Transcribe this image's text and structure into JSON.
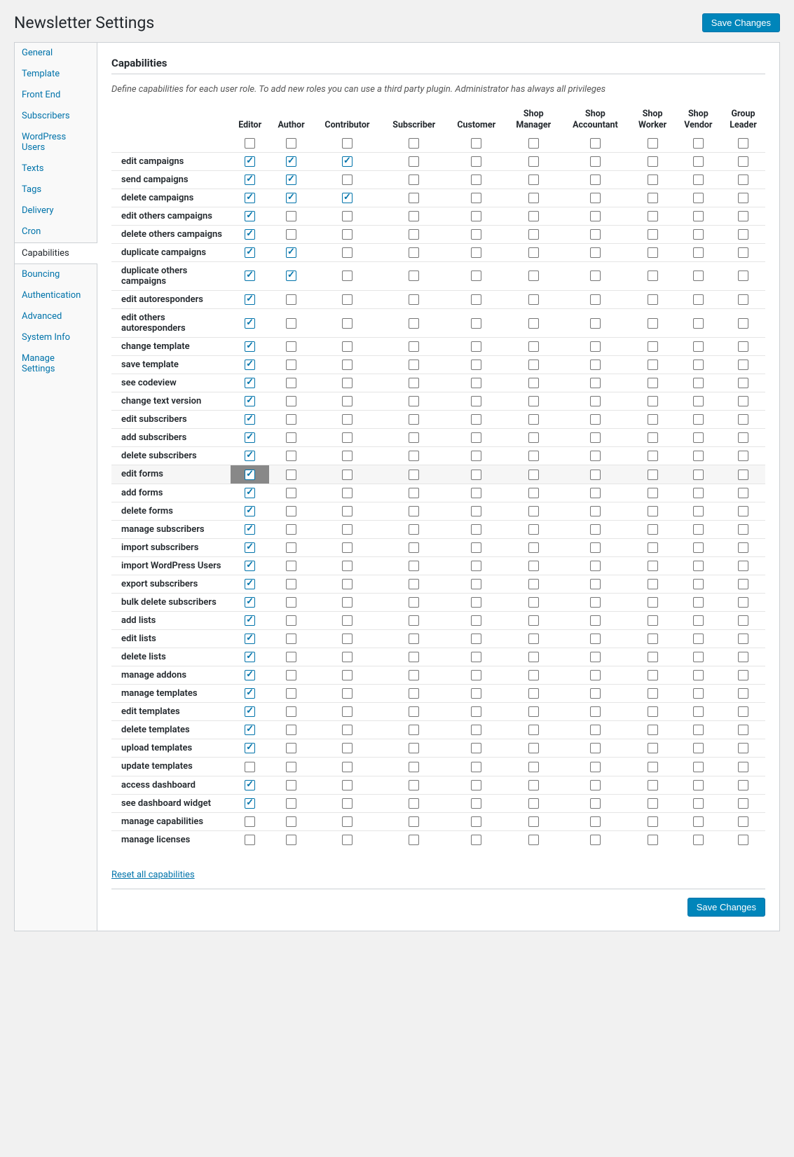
{
  "page_title": "Newsletter Settings",
  "buttons": {
    "save_changes": "Save Changes"
  },
  "sidebar": {
    "items": [
      {
        "label": "General",
        "active": false
      },
      {
        "label": "Template",
        "active": false
      },
      {
        "label": "Front End",
        "active": false
      },
      {
        "label": "Subscribers",
        "active": false
      },
      {
        "label": "WordPress Users",
        "active": false
      },
      {
        "label": "Texts",
        "active": false
      },
      {
        "label": "Tags",
        "active": false
      },
      {
        "label": "Delivery",
        "active": false
      },
      {
        "label": "Cron",
        "active": false
      },
      {
        "label": "Capabilities",
        "active": true
      },
      {
        "label": "Bouncing",
        "active": false
      },
      {
        "label": "Authentication",
        "active": false
      },
      {
        "label": "Advanced",
        "active": false
      },
      {
        "label": "System Info",
        "active": false
      },
      {
        "label": "Manage Settings",
        "active": false
      }
    ]
  },
  "section": {
    "title": "Capabilities",
    "description": "Define capabilities for each user role. To add new roles you can use a third party plugin. Administrator has always all privileges"
  },
  "roles": [
    "Editor",
    "Author",
    "Contributor",
    "Subscriber",
    "Customer",
    "Shop Manager",
    "Shop Accountant",
    "Shop Worker",
    "Shop Vendor",
    "Group Leader"
  ],
  "capabilities": [
    {
      "label": "edit campaigns",
      "highlight": false,
      "values": [
        true,
        true,
        true,
        false,
        false,
        false,
        false,
        false,
        false,
        false
      ]
    },
    {
      "label": "send campaigns",
      "highlight": false,
      "values": [
        true,
        true,
        false,
        false,
        false,
        false,
        false,
        false,
        false,
        false
      ]
    },
    {
      "label": "delete campaigns",
      "highlight": false,
      "values": [
        true,
        true,
        true,
        false,
        false,
        false,
        false,
        false,
        false,
        false
      ]
    },
    {
      "label": "edit others campaigns",
      "highlight": false,
      "values": [
        true,
        false,
        false,
        false,
        false,
        false,
        false,
        false,
        false,
        false
      ]
    },
    {
      "label": "delete others campaigns",
      "highlight": false,
      "values": [
        true,
        false,
        false,
        false,
        false,
        false,
        false,
        false,
        false,
        false
      ]
    },
    {
      "label": "duplicate campaigns",
      "highlight": false,
      "values": [
        true,
        true,
        false,
        false,
        false,
        false,
        false,
        false,
        false,
        false
      ]
    },
    {
      "label": "duplicate others campaigns",
      "highlight": false,
      "values": [
        true,
        true,
        false,
        false,
        false,
        false,
        false,
        false,
        false,
        false
      ]
    },
    {
      "label": "edit autoresponders",
      "highlight": false,
      "values": [
        true,
        false,
        false,
        false,
        false,
        false,
        false,
        false,
        false,
        false
      ]
    },
    {
      "label": "edit others autoresponders",
      "highlight": false,
      "values": [
        true,
        false,
        false,
        false,
        false,
        false,
        false,
        false,
        false,
        false
      ]
    },
    {
      "label": "change template",
      "highlight": false,
      "values": [
        true,
        false,
        false,
        false,
        false,
        false,
        false,
        false,
        false,
        false
      ]
    },
    {
      "label": "save template",
      "highlight": false,
      "values": [
        true,
        false,
        false,
        false,
        false,
        false,
        false,
        false,
        false,
        false
      ]
    },
    {
      "label": "see codeview",
      "highlight": false,
      "values": [
        true,
        false,
        false,
        false,
        false,
        false,
        false,
        false,
        false,
        false
      ]
    },
    {
      "label": "change text version",
      "highlight": false,
      "values": [
        true,
        false,
        false,
        false,
        false,
        false,
        false,
        false,
        false,
        false
      ]
    },
    {
      "label": "edit subscribers",
      "highlight": false,
      "values": [
        true,
        false,
        false,
        false,
        false,
        false,
        false,
        false,
        false,
        false
      ]
    },
    {
      "label": "add subscribers",
      "highlight": false,
      "values": [
        true,
        false,
        false,
        false,
        false,
        false,
        false,
        false,
        false,
        false
      ]
    },
    {
      "label": "delete subscribers",
      "highlight": false,
      "values": [
        true,
        false,
        false,
        false,
        false,
        false,
        false,
        false,
        false,
        false
      ]
    },
    {
      "label": "edit forms",
      "highlight": true,
      "values": [
        true,
        false,
        false,
        false,
        false,
        false,
        false,
        false,
        false,
        false
      ]
    },
    {
      "label": "add forms",
      "highlight": false,
      "values": [
        true,
        false,
        false,
        false,
        false,
        false,
        false,
        false,
        false,
        false
      ]
    },
    {
      "label": "delete forms",
      "highlight": false,
      "values": [
        true,
        false,
        false,
        false,
        false,
        false,
        false,
        false,
        false,
        false
      ]
    },
    {
      "label": "manage subscribers",
      "highlight": false,
      "values": [
        true,
        false,
        false,
        false,
        false,
        false,
        false,
        false,
        false,
        false
      ]
    },
    {
      "label": "import subscribers",
      "highlight": false,
      "values": [
        true,
        false,
        false,
        false,
        false,
        false,
        false,
        false,
        false,
        false
      ]
    },
    {
      "label": "import WordPress Users",
      "highlight": false,
      "values": [
        true,
        false,
        false,
        false,
        false,
        false,
        false,
        false,
        false,
        false
      ]
    },
    {
      "label": "export subscribers",
      "highlight": false,
      "values": [
        true,
        false,
        false,
        false,
        false,
        false,
        false,
        false,
        false,
        false
      ]
    },
    {
      "label": "bulk delete subscribers",
      "highlight": false,
      "values": [
        true,
        false,
        false,
        false,
        false,
        false,
        false,
        false,
        false,
        false
      ]
    },
    {
      "label": "add lists",
      "highlight": false,
      "values": [
        true,
        false,
        false,
        false,
        false,
        false,
        false,
        false,
        false,
        false
      ]
    },
    {
      "label": "edit lists",
      "highlight": false,
      "values": [
        true,
        false,
        false,
        false,
        false,
        false,
        false,
        false,
        false,
        false
      ]
    },
    {
      "label": "delete lists",
      "highlight": false,
      "values": [
        true,
        false,
        false,
        false,
        false,
        false,
        false,
        false,
        false,
        false
      ]
    },
    {
      "label": "manage addons",
      "highlight": false,
      "values": [
        true,
        false,
        false,
        false,
        false,
        false,
        false,
        false,
        false,
        false
      ]
    },
    {
      "label": "manage templates",
      "highlight": false,
      "values": [
        true,
        false,
        false,
        false,
        false,
        false,
        false,
        false,
        false,
        false
      ]
    },
    {
      "label": "edit templates",
      "highlight": false,
      "values": [
        true,
        false,
        false,
        false,
        false,
        false,
        false,
        false,
        false,
        false
      ]
    },
    {
      "label": "delete templates",
      "highlight": false,
      "values": [
        true,
        false,
        false,
        false,
        false,
        false,
        false,
        false,
        false,
        false
      ]
    },
    {
      "label": "upload templates",
      "highlight": false,
      "values": [
        true,
        false,
        false,
        false,
        false,
        false,
        false,
        false,
        false,
        false
      ]
    },
    {
      "label": "update templates",
      "highlight": false,
      "values": [
        false,
        false,
        false,
        false,
        false,
        false,
        false,
        false,
        false,
        false
      ]
    },
    {
      "label": "access dashboard",
      "highlight": false,
      "values": [
        true,
        false,
        false,
        false,
        false,
        false,
        false,
        false,
        false,
        false
      ]
    },
    {
      "label": "see dashboard widget",
      "highlight": false,
      "values": [
        true,
        false,
        false,
        false,
        false,
        false,
        false,
        false,
        false,
        false
      ]
    },
    {
      "label": "manage capabilities",
      "highlight": false,
      "values": [
        false,
        false,
        false,
        false,
        false,
        false,
        false,
        false,
        false,
        false
      ]
    },
    {
      "label": "manage licenses",
      "highlight": false,
      "values": [
        false,
        false,
        false,
        false,
        false,
        false,
        false,
        false,
        false,
        false
      ]
    }
  ],
  "reset_link": "Reset all capabilities"
}
